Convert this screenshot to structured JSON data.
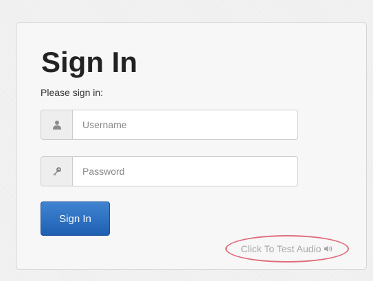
{
  "form": {
    "title": "Sign In",
    "subtitle": "Please sign in:",
    "username_placeholder": "Username",
    "username_icon": "user-icon",
    "password_placeholder": "Password",
    "password_icon": "key-icon",
    "submit_label": "Sign In",
    "test_audio_label": "Click To Test Audio",
    "test_audio_icon": "speaker-icon"
  },
  "colors": {
    "button_top": "#3f84d1",
    "button_bottom": "#1f5fb3",
    "highlight_ellipse": "#e06b7a",
    "muted_text": "#a6a6a6"
  }
}
